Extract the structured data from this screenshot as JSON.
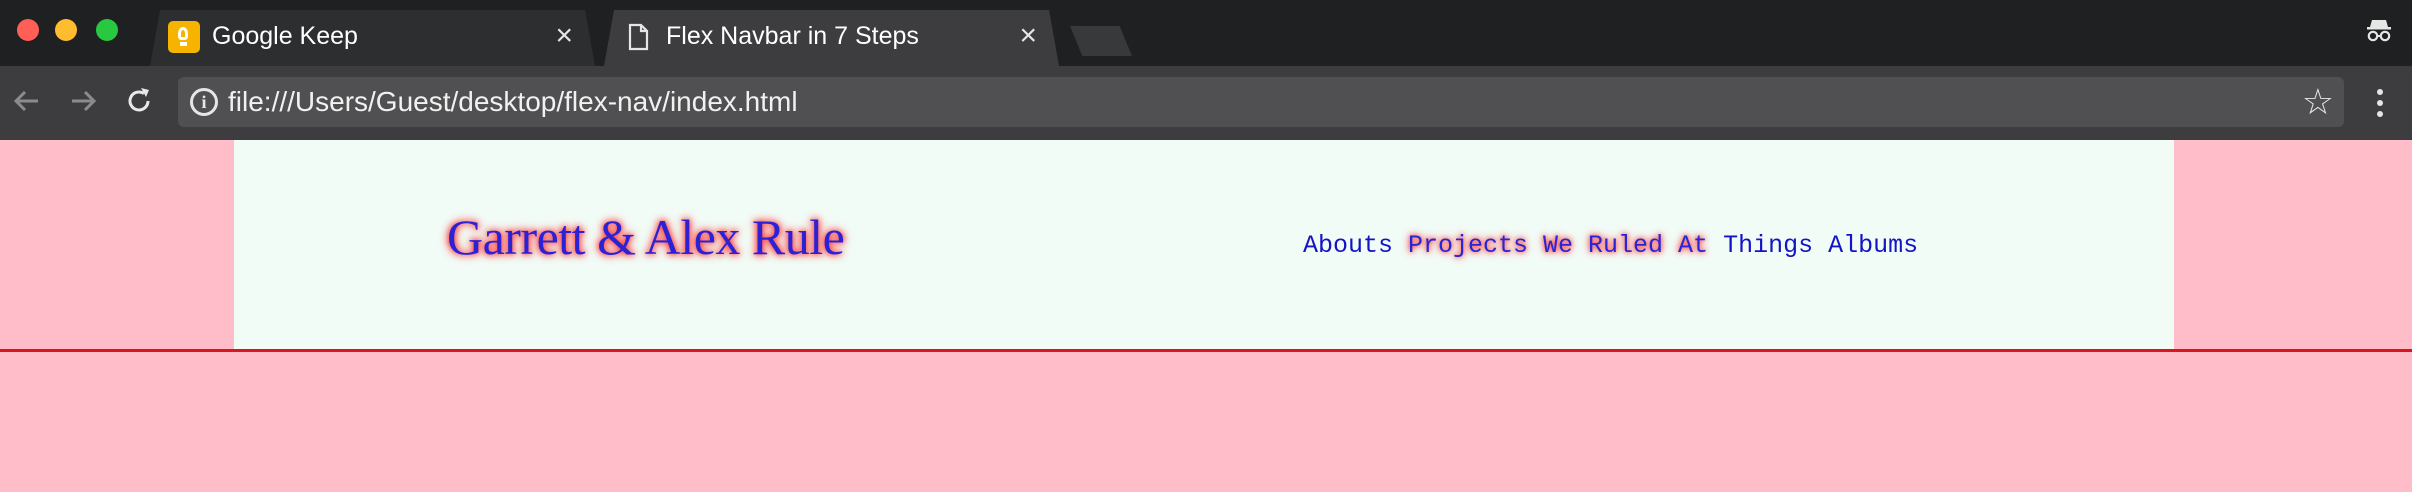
{
  "browser": {
    "tabs": [
      {
        "title": "Google Keep",
        "icon": "keep-bulb-icon",
        "active": false
      },
      {
        "title": "Flex Navbar in 7 Steps",
        "icon": "document-icon",
        "active": true
      }
    ],
    "close_glyph": "×",
    "address": "file:///Users/Guest/desktop/flex-nav/index.html"
  },
  "page": {
    "logo": "Garrett & Alex Rule",
    "nav": [
      {
        "label": "Abouts",
        "highlighted": false
      },
      {
        "label": "Projects We Ruled At",
        "highlighted": true
      },
      {
        "label": "Things",
        "highlighted": false
      },
      {
        "label": "Albums",
        "highlighted": false
      }
    ]
  },
  "colors": {
    "page_bg": "#ffbdc9",
    "header_bg": "#f2fcf7",
    "rule": "#d9161f",
    "link": "#1414c6",
    "glow": "#ff2a2a"
  }
}
